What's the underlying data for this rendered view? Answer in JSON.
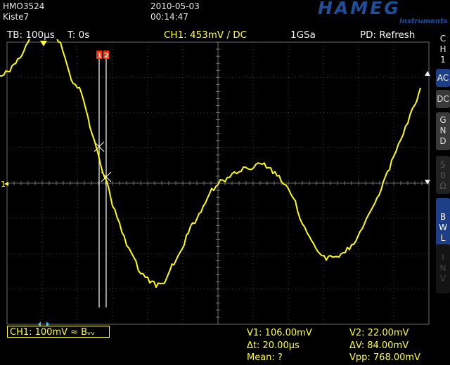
{
  "header": {
    "model": "HMO3524",
    "name": "Kiste7",
    "date": "2010-05-03",
    "time": "00:14:47",
    "brand": "HAMEG",
    "brand_sub": "Instruments"
  },
  "status_bar": {
    "timebase": "TB: 100µs",
    "trigger_time": "T: 0s",
    "channel": "CH1: 453mV ∕ DC",
    "sample_rate": "1GSa",
    "display_mode": "PD: Refresh"
  },
  "side_panel": {
    "channel_label": [
      "C",
      "H",
      "1"
    ],
    "ac": "AC",
    "dc": "DC",
    "gnd": [
      "G",
      "N",
      "D"
    ],
    "fifty_ohm": [
      "5",
      "0",
      "Ω"
    ],
    "bwl": [
      "B",
      "W",
      "L"
    ],
    "inv": [
      "I",
      "N",
      "V"
    ]
  },
  "cursors": {
    "label1": "1",
    "label2": "2"
  },
  "bottom": {
    "ch1_scale": "CH1: 100mV ≈ Bᵥᵥ",
    "v1": "V1: 106.00mV",
    "v2": "V2: 22.00mV",
    "dt": "Δt: 20.00µs",
    "dv": "ΔV: 84.00mV",
    "mean": "Mean: ?",
    "vpp": "Vpp: 768.00mV"
  },
  "colors": {
    "trace": "#ffff00",
    "grid": "#6a6a6a",
    "brand": "#1e4f9c",
    "cursor_label": "#ff2a00",
    "side_active": "#1e3f88"
  },
  "waveform": {
    "x": [
      0,
      14,
      28,
      40,
      52,
      58,
      74,
      86,
      96,
      104,
      110,
      116,
      122,
      128,
      134,
      140,
      146,
      152,
      160,
      170,
      180,
      190,
      200,
      210,
      222,
      234,
      242,
      250,
      262,
      274,
      286,
      298,
      310,
      320,
      330,
      340,
      352,
      364,
      376,
      388,
      400,
      410,
      420,
      430,
      440,
      452,
      464,
      476,
      488,
      500,
      512,
      524,
      536,
      548,
      560,
      570,
      580,
      590,
      598
    ],
    "y": [
      110,
      100,
      82,
      58,
      45,
      42,
      45,
      62,
      98,
      118,
      125,
      132,
      155,
      182,
      198,
      222,
      245,
      260,
      292,
      318,
      345,
      368,
      388,
      398,
      405,
      400,
      385,
      370,
      345,
      320,
      300,
      275,
      262,
      255,
      248,
      245,
      240,
      236,
      235,
      245,
      258,
      270,
      290,
      320,
      338,
      360,
      370,
      365,
      362,
      350,
      330,
      306,
      284,
      252,
      222,
      198,
      172,
      150,
      125
    ]
  }
}
